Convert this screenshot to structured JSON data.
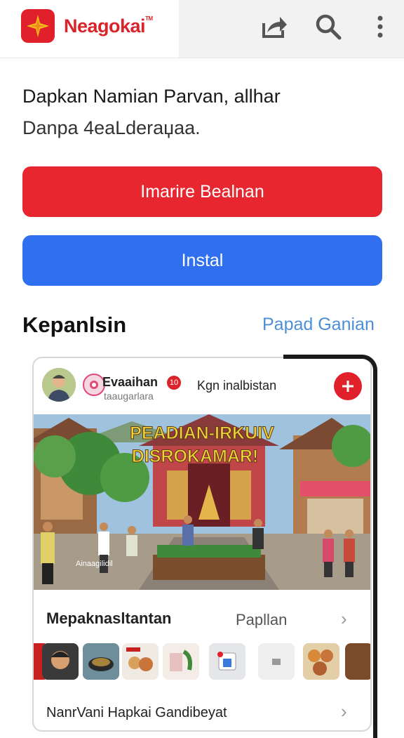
{
  "app": {
    "brand": "Neagokai",
    "brand_mark": "TM"
  },
  "toolbar": {
    "share_icon": "share-icon",
    "search_icon": "search-icon",
    "menu_icon": "more-vert-icon"
  },
  "intro": {
    "line1": "Dapkan Namian Parvan, allhar",
    "line2": "Danpa 4eaLderaџaa."
  },
  "buttons": {
    "primary": "Imarire Bealnan",
    "install": "Instal"
  },
  "section": {
    "title": "Kepanlsin",
    "link": "Papad Ganian"
  },
  "post": {
    "name": "Evaaihan",
    "badge": "10",
    "subtitle": "taaugarlara",
    "label": "Kgn inalbistan",
    "banner_line1": "PEADIAN-IRKUIV",
    "banner_line2": "DISROKAMAR!",
    "sign": "Ainaagilidil"
  },
  "row1": {
    "title": "Mepaknasltantan",
    "link": "Papllan"
  },
  "row2": {
    "title": "NanrVani Hapkai Gandibeyat"
  },
  "colors": {
    "brand_red": "#e0202a",
    "install_blue": "#2f6ff0",
    "link_blue": "#4d8fd6"
  }
}
